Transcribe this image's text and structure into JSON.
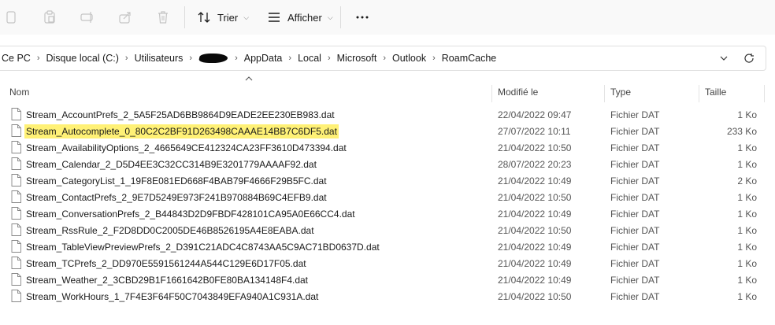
{
  "toolbar": {
    "sort_label": "Trier",
    "view_label": "Afficher"
  },
  "address": {
    "crumbs": [
      "Ce PC",
      "Disque local (C:)",
      "Utilisateurs",
      "AppData",
      "Local",
      "Microsoft",
      "Outlook",
      "RoamCache"
    ]
  },
  "columns": {
    "name": "Nom",
    "modified": "Modifié le",
    "type": "Type",
    "size": "Taille"
  },
  "files": [
    {
      "name": "Stream_AccountPrefs_2_5A5F25AD6BB9864D9EADE2EE230EB983.dat",
      "modified": "22/04/2022 09:47",
      "type": "Fichier DAT",
      "size": "1 Ko"
    },
    {
      "name": "Stream_Autocomplete_0_80C2C2BF91D263498CAAAE14BB7C6DF5.dat",
      "modified": "27/07/2022 10:11",
      "type": "Fichier DAT",
      "size": "233 Ko"
    },
    {
      "name": "Stream_AvailabilityOptions_2_4665649CE412324CA23FF3610D473394.dat",
      "modified": "21/04/2022 10:50",
      "type": "Fichier DAT",
      "size": "1 Ko"
    },
    {
      "name": "Stream_Calendar_2_D5D4EE3C32CC314B9E3201779AAAAF92.dat",
      "modified": "28/07/2022 20:23",
      "type": "Fichier DAT",
      "size": "1 Ko"
    },
    {
      "name": "Stream_CategoryList_1_19F8E081ED668F4BAB79F4666F29B5FC.dat",
      "modified": "21/04/2022 10:49",
      "type": "Fichier DAT",
      "size": "2 Ko"
    },
    {
      "name": "Stream_ContactPrefs_2_9E7D5249E973F241B970884B69C4EFB9.dat",
      "modified": "21/04/2022 10:50",
      "type": "Fichier DAT",
      "size": "1 Ko"
    },
    {
      "name": "Stream_ConversationPrefs_2_B44843D2D9FBDF428101CA95A0E66CC4.dat",
      "modified": "21/04/2022 10:49",
      "type": "Fichier DAT",
      "size": "1 Ko"
    },
    {
      "name": "Stream_RssRule_2_F2D8DD0C2005DE46B8526195A4E8EABA.dat",
      "modified": "21/04/2022 10:50",
      "type": "Fichier DAT",
      "size": "1 Ko"
    },
    {
      "name": "Stream_TableViewPreviewPrefs_2_D391C21ADC4C8743AA5C9AC71BD0637D.dat",
      "modified": "21/04/2022 10:49",
      "type": "Fichier DAT",
      "size": "1 Ko"
    },
    {
      "name": "Stream_TCPrefs_2_DD970E5591561244A544C129E6D17F05.dat",
      "modified": "21/04/2022 10:49",
      "type": "Fichier DAT",
      "size": "1 Ko"
    },
    {
      "name": "Stream_Weather_2_3CBD29B1F1661642B0FE80BA134148F4.dat",
      "modified": "21/04/2022 10:49",
      "type": "Fichier DAT",
      "size": "1 Ko"
    },
    {
      "name": "Stream_WorkHours_1_7F4E3F64F50C7043849EFA940A1C931A.dat",
      "modified": "21/04/2022 10:50",
      "type": "Fichier DAT",
      "size": "1 Ko"
    }
  ],
  "highlight_color": "#fff176"
}
